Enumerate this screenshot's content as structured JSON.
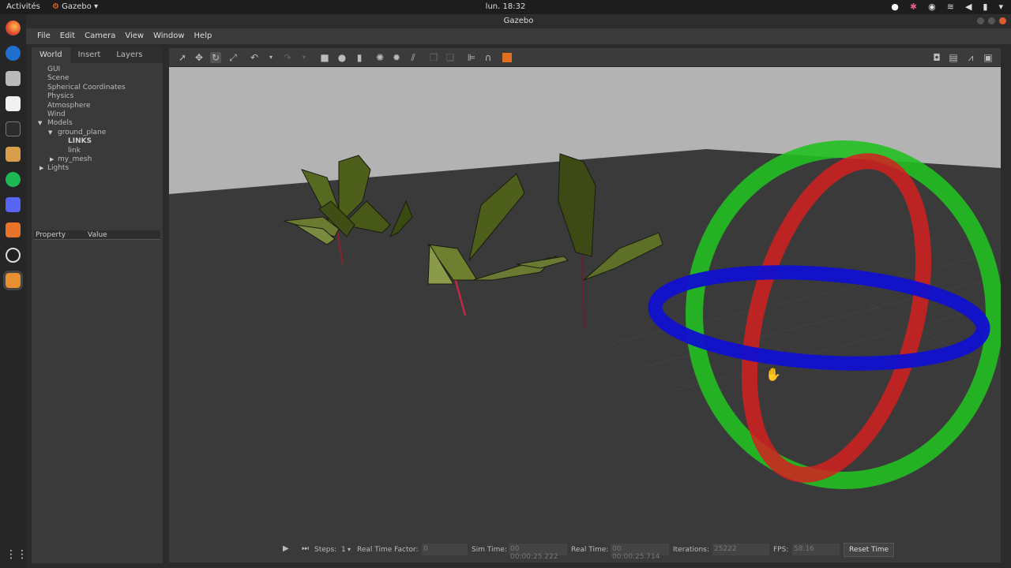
{
  "topbar": {
    "activities": "Activités",
    "app_name": "Gazebo",
    "clock": "lun. 18:32"
  },
  "window": {
    "title": "Gazebo"
  },
  "menu": [
    "File",
    "Edit",
    "Camera",
    "View",
    "Window",
    "Help"
  ],
  "left_panel": {
    "tabs": [
      "World",
      "Insert",
      "Layers"
    ],
    "tree": {
      "gui": "GUI",
      "scene": "Scene",
      "spherical": "Spherical Coordinates",
      "physics": "Physics",
      "atmosphere": "Atmosphere",
      "wind": "Wind",
      "models": "Models",
      "ground_plane": "ground_plane",
      "links": "LINKS",
      "link": "link",
      "my_mesh": "my_mesh",
      "lights": "Lights"
    },
    "property_header": {
      "property": "Property",
      "value": "Value"
    }
  },
  "bottom": {
    "steps_label": "Steps:",
    "steps_value": "1",
    "rtf_label": "Real Time Factor:",
    "rtf_value": "0",
    "sim_time_label": "Sim Time:",
    "sim_time_value": "00 00:00:25.222",
    "real_time_label": "Real Time:",
    "real_time_value": "00 00:00:25.714",
    "iterations_label": "Iterations:",
    "iterations_value": "25222",
    "fps_label": "FPS:",
    "fps_value": "58.16",
    "reset_label": "Reset Time"
  },
  "colors": {
    "rot_x": "#d42020",
    "rot_y": "#22c022",
    "rot_z": "#1010d0",
    "ground": "#3a3a3a",
    "sky": "#b3b3b3",
    "leaf": "#4a5a1c"
  }
}
